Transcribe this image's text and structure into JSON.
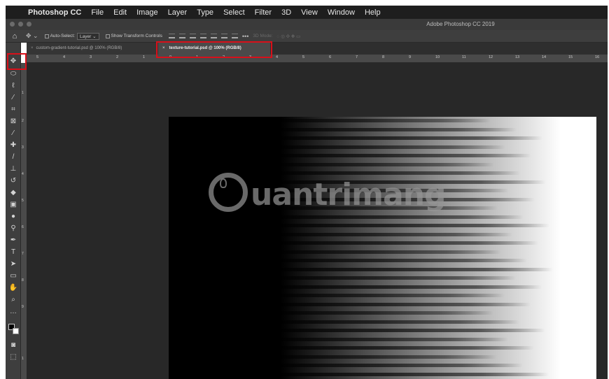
{
  "menubar": {
    "app_name": "Photoshop CC",
    "items": [
      "File",
      "Edit",
      "Image",
      "Layer",
      "Type",
      "Select",
      "Filter",
      "3D",
      "View",
      "Window",
      "Help"
    ]
  },
  "titlebar": {
    "title": "Adobe Photoshop CC 2019"
  },
  "options": {
    "auto_select_label": "Auto-Select:",
    "auto_select_value": "Layer",
    "show_transform_label": "Show Transform Controls",
    "mode_label": "3D Mode:"
  },
  "tabs": [
    {
      "label": "custom-gradient-tutorial.psd @ 100% (RGB/8)"
    },
    {
      "label": "texture-tutorial.psd @ 100% (RGB/8)"
    }
  ],
  "ruler_top": [
    "5",
    "4",
    "3",
    "2",
    "1",
    "0",
    "1",
    "2",
    "3",
    "4",
    "5",
    "6",
    "7",
    "8",
    "9",
    "10",
    "11",
    "12",
    "13",
    "14",
    "15",
    "16"
  ],
  "ruler_left": [
    "1",
    "2",
    "3",
    "4",
    "5",
    "6",
    "7",
    "8",
    "9",
    "1"
  ],
  "watermark": {
    "text": "uantrimang"
  },
  "colors": {
    "highlight": "#d8101a",
    "pasteboard": "#282828",
    "ui_panel": "#3e3e3e"
  }
}
